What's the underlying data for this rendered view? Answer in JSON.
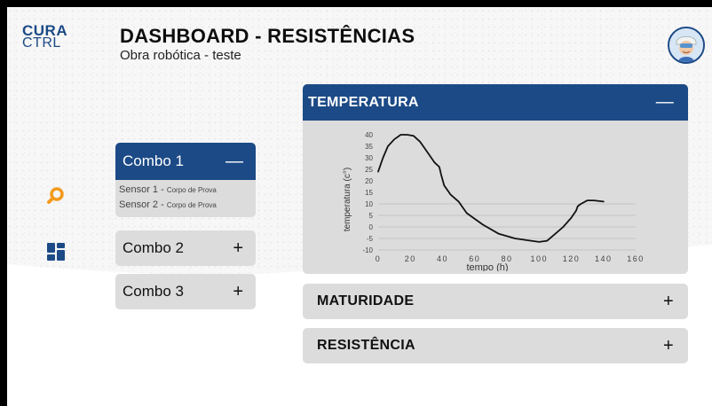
{
  "logo": {
    "line1": "CURA",
    "line2": "CTRL"
  },
  "header": {
    "title": "DASHBOARD - RESISTÊNCIAS",
    "subtitle": "Obra robótica - teste"
  },
  "sidebar": {
    "icons": [
      "search-icon",
      "dashboard-icon"
    ]
  },
  "combos": [
    {
      "label": "Combo 1",
      "sign": "—",
      "expanded": true,
      "sensors": [
        {
          "name": "Sensor 1 - ",
          "detail": "Corpo de Prova"
        },
        {
          "name": "Sensor 2 - ",
          "detail": "Corpo de Prova"
        }
      ]
    },
    {
      "label": "Combo 2",
      "sign": "+",
      "expanded": false
    },
    {
      "label": "Combo 3",
      "sign": "+",
      "expanded": false
    }
  ],
  "panels": {
    "temperatura": {
      "label": "TEMPERATURA",
      "sign": "—"
    },
    "maturidade": {
      "label": "MATURIDADE",
      "sign": "+"
    },
    "resistencia": {
      "label": "RESISTÊNCIA",
      "sign": "+"
    }
  },
  "colors": {
    "primary": "#1c4a86",
    "panel": "#dcdcdc"
  },
  "chart_data": {
    "type": "line",
    "title": "",
    "xlabel": "tempo (h)",
    "ylabel": "temperatura (c°)",
    "xlim": [
      0,
      160
    ],
    "ylim": [
      -10,
      40
    ],
    "xticks": [
      0,
      20,
      40,
      60,
      80,
      100,
      120,
      140,
      160
    ],
    "yticks": [
      -10,
      -5,
      0,
      5,
      10,
      15,
      20,
      25,
      30,
      35,
      40
    ],
    "grid": "horizontal-below-zero",
    "series": [
      {
        "x": [
          0,
          3,
          6,
          10,
          14,
          18,
          22,
          26,
          29,
          32,
          35,
          38,
          39,
          41,
          45,
          50,
          55,
          65,
          75,
          85,
          95,
          100,
          105,
          110,
          115,
          120,
          123,
          124,
          126,
          130,
          134,
          140
        ],
        "y": [
          24,
          30,
          35,
          38,
          40,
          40,
          39.5,
          37,
          34,
          31,
          28,
          26,
          23,
          18,
          14,
          11,
          6,
          1,
          -3,
          -5,
          -6,
          -6.5,
          -6,
          -3,
          0,
          4,
          7,
          9,
          10,
          11.5,
          11.5,
          11
        ]
      }
    ]
  }
}
